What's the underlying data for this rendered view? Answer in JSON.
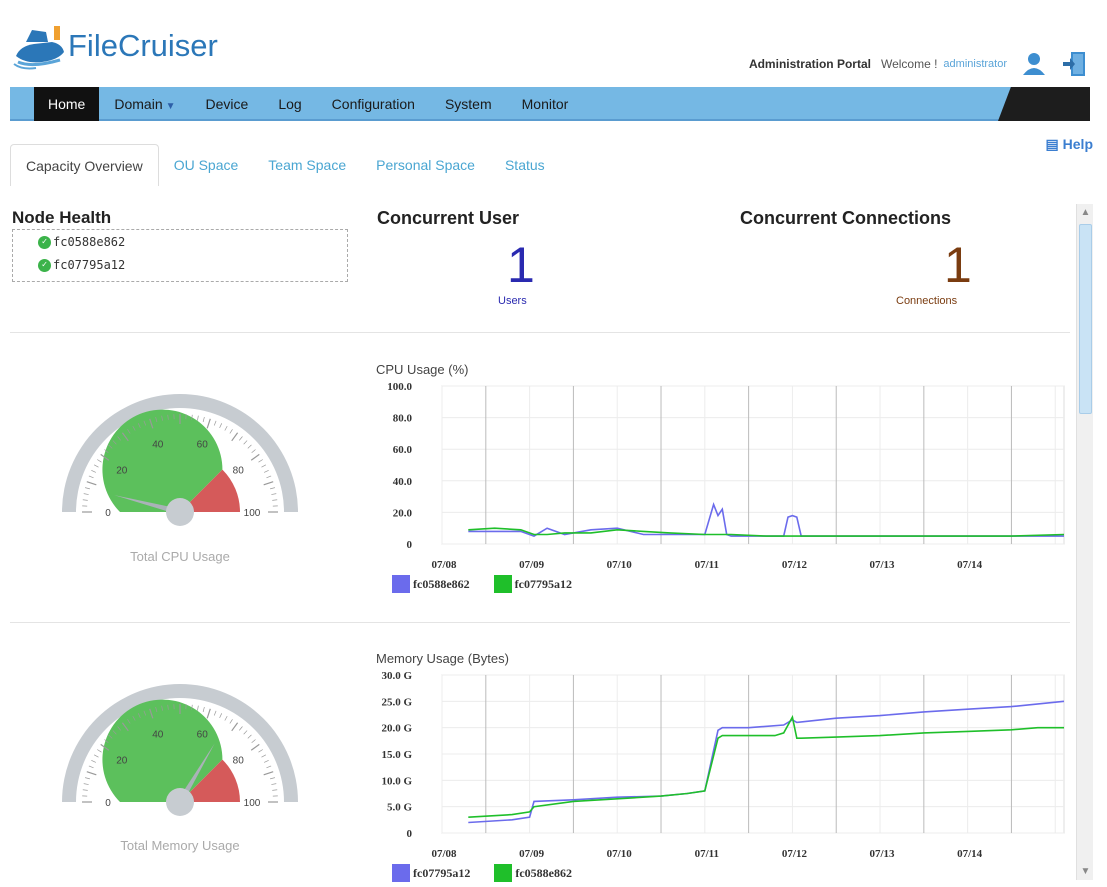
{
  "header": {
    "brand": "FileCruiser",
    "portal": "Administration Portal",
    "welcome": "Welcome !",
    "username": "administrator"
  },
  "nav": {
    "items": [
      {
        "label": "Home",
        "active": true
      },
      {
        "label": "Domain",
        "dropdown": true
      },
      {
        "label": "Device"
      },
      {
        "label": "Log"
      },
      {
        "label": "Configuration"
      },
      {
        "label": "System"
      },
      {
        "label": "Monitor"
      }
    ]
  },
  "subtabs": [
    "Capacity Overview",
    "OU Space",
    "Team Space",
    "Personal Space",
    "Status"
  ],
  "help": "Help",
  "node_health": {
    "title": "Node Health",
    "nodes": [
      "fc0588e862",
      "fc07795a12"
    ]
  },
  "concurrent_user": {
    "title": "Concurrent User",
    "value": "1",
    "unit": "Users"
  },
  "concurrent_connections": {
    "title": "Concurrent Connections",
    "value": "1",
    "unit": "Connections"
  },
  "gauges": [
    {
      "label": "Total CPU Usage",
      "ticks": [
        "0",
        "20",
        "40",
        "60",
        "80",
        "100"
      ],
      "value": 8
    },
    {
      "label": "Total Memory Usage",
      "ticks": [
        "0",
        "20",
        "40",
        "60",
        "80",
        "100"
      ],
      "value": 67
    }
  ],
  "colors": {
    "nav": "#75b8e4",
    "series_blue": "#6b6bec",
    "series_green": "#1fbf2a",
    "gauge_green": "#5cc05c",
    "gauge_red": "#d55a5a"
  },
  "chart_data": [
    {
      "type": "line",
      "title": "CPU Usage (%)",
      "ylim": [
        0,
        100
      ],
      "yticks": [
        "100.0",
        "80.0",
        "60.0",
        "40.0",
        "20.0",
        "0"
      ],
      "xticks": [
        "07/08",
        "07/09",
        "07/10",
        "07/11",
        "07/12",
        "07/13",
        "07/14"
      ],
      "series": [
        {
          "name": "fc0588e862",
          "color": "#6b6bec",
          "x": [
            7.8,
            8.1,
            8.4,
            8.55,
            8.7,
            8.9,
            9.2,
            9.5,
            9.8,
            10.1,
            10.5,
            10.6,
            10.65,
            10.7,
            10.75,
            10.8,
            10.9,
            11.2,
            11.4,
            11.45,
            11.5,
            11.55,
            11.6,
            11.7,
            12.2,
            12.8,
            13.4,
            14.0,
            14.6
          ],
          "y": [
            8,
            8,
            8,
            5,
            10,
            6,
            9,
            10,
            6,
            6,
            6,
            25,
            18,
            22,
            6,
            5,
            5,
            5,
            5,
            17,
            18,
            17,
            5,
            5,
            5,
            5,
            5,
            5,
            5
          ]
        },
        {
          "name": "fc07795a12",
          "color": "#1fbf2a",
          "x": [
            7.8,
            8.1,
            8.4,
            8.55,
            8.7,
            8.9,
            9.2,
            9.5,
            9.8,
            10.1,
            10.5,
            10.8,
            11.2,
            11.6,
            12.2,
            12.8,
            13.4,
            14.0,
            14.6
          ],
          "y": [
            9,
            10,
            9,
            6,
            6,
            7,
            7,
            9,
            8,
            7,
            6,
            6,
            5,
            5,
            5,
            5,
            5,
            5,
            6
          ]
        }
      ]
    },
    {
      "type": "line",
      "title": "Memory Usage (Bytes)",
      "ylim": [
        0,
        30
      ],
      "yticks": [
        "30.0 G",
        "25.0 G",
        "20.0 G",
        "15.0 G",
        "10.0 G",
        "5.0 G",
        "0"
      ],
      "xticks": [
        "07/08",
        "07/09",
        "07/10",
        "07/11",
        "07/12",
        "07/13",
        "07/14"
      ],
      "series": [
        {
          "name": "fc07795a12",
          "color": "#6b6bec",
          "x": [
            7.8,
            8.3,
            8.5,
            8.55,
            9.0,
            9.5,
            10.0,
            10.3,
            10.5,
            10.65,
            10.7,
            10.8,
            11.0,
            11.4,
            11.5,
            11.55,
            12.0,
            12.5,
            13.0,
            13.5,
            14.0,
            14.6
          ],
          "y": [
            2,
            2.5,
            3,
            6,
            6.3,
            6.8,
            7,
            7.5,
            8,
            19.5,
            20,
            20,
            20,
            20.5,
            21.5,
            21,
            21.8,
            22.3,
            23,
            23.5,
            24,
            25
          ]
        },
        {
          "name": "fc0588e862",
          "color": "#1fbf2a",
          "x": [
            7.8,
            8.3,
            8.5,
            8.55,
            9.0,
            9.5,
            10.0,
            10.3,
            10.5,
            10.65,
            10.7,
            11.0,
            11.3,
            11.4,
            11.5,
            11.55,
            11.6,
            12.0,
            12.5,
            13.0,
            13.5,
            14.0,
            14.3,
            14.6
          ],
          "y": [
            3,
            3.5,
            4,
            5,
            6,
            6.5,
            7,
            7.5,
            8,
            18,
            18.5,
            18.5,
            18.5,
            19,
            22,
            18,
            18,
            18.2,
            18.5,
            19,
            19.3,
            19.6,
            20,
            20
          ]
        }
      ]
    }
  ]
}
